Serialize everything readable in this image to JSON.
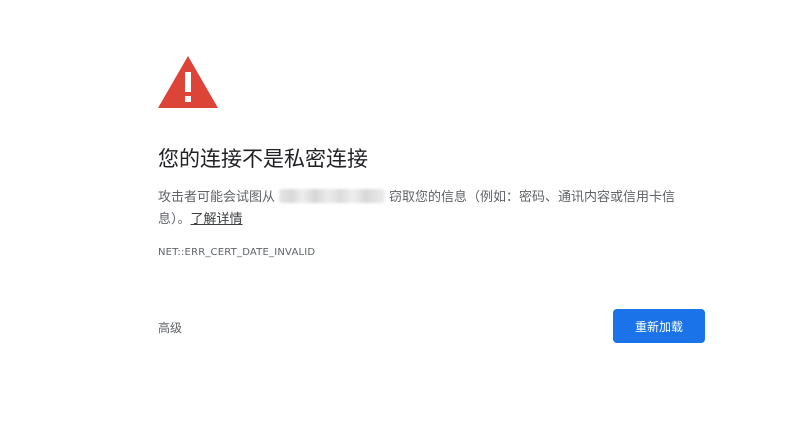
{
  "warning": {
    "icon": "warning-triangle-icon",
    "color": "#db4437"
  },
  "title": "您的连接不是私密连接",
  "explanation": {
    "prefix": "攻击者可能会试图从",
    "suffix": "窃取您的信息（例如：密码、通讯内容或信用卡信息）。",
    "learn_more": "了解详情"
  },
  "error_code": "NET::ERR_CERT_DATE_INVALID",
  "buttons": {
    "advanced_label": "高级",
    "reload_label": "重新加载",
    "reload_color": "#1a73e8"
  }
}
